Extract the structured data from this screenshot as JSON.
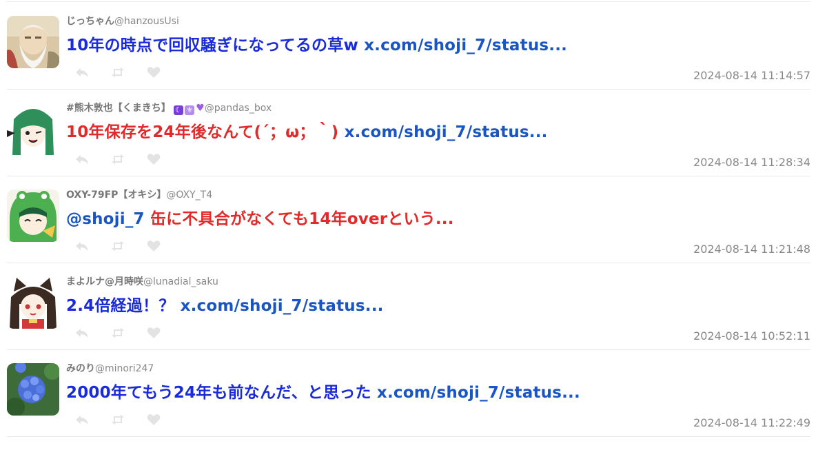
{
  "tweets": [
    {
      "display_name": "じっちゃん",
      "handle": "@hanzousUsi",
      "text": "10年の時点で回収騒ぎになってるの草w",
      "text_color": "#1a2bd9",
      "link": "x.com/shoji_7/status...",
      "timestamp": "2024-08-14 11:14:57",
      "avatar_icon": "old-man-avatar"
    },
    {
      "display_name": "#熊木敦也【くまきち】",
      "handle": "@pandas_box",
      "text": "10年保存を24年後なんて(´；ω；｀)",
      "text_color": "#e22a2a",
      "link": "x.com/shoji_7/status...",
      "timestamp": "2024-08-14 11:28:34",
      "avatar_icon": "green-hair-avatar"
    },
    {
      "display_name": "OXY-79FP【オキシ】",
      "handle": "@OXY_T4",
      "mention": "@shoji_7",
      "text": "缶に不具合がなくても14年overという...",
      "text_color": "#e22a2a",
      "link": "",
      "timestamp": "2024-08-14 11:21:48",
      "avatar_icon": "frog-hood-avatar"
    },
    {
      "display_name": "まよルナ@月時咲",
      "handle": "@lunadial_saku",
      "text": "2.4倍経過！？",
      "text_color": "#1a2bd9",
      "link": "x.com/shoji_7/status...",
      "timestamp": "2024-08-14 10:52:11",
      "avatar_icon": "cat-ear-avatar"
    },
    {
      "display_name": "みのり",
      "handle": "@minori247",
      "text": "2000年てもう24年も前なんだ、と思った",
      "text_color": "#1a2bd9",
      "link": "x.com/shoji_7/status...",
      "timestamp": "2024-08-14 11:22:49",
      "avatar_icon": "hydrangea-avatar"
    }
  ],
  "colors": {
    "link": "#1a55c4",
    "meta": "#888888",
    "action_icon": "#e3e3e3",
    "divider": "#e8e8e8"
  },
  "icons": {
    "reply": "reply-icon",
    "retweet": "retweet-icon",
    "like": "heart-icon",
    "badge_moon": "moon-badge-icon",
    "badge_fleur": "fleur-badge-icon",
    "badge_heart": "purple-heart-icon"
  }
}
